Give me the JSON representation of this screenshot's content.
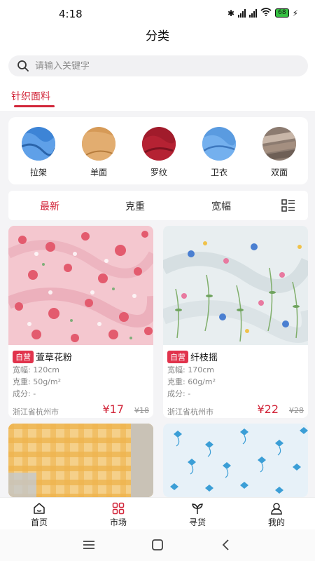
{
  "status_bar": {
    "time": "4:18",
    "battery": "68",
    "signal1": "HD",
    "signal2": "HD"
  },
  "header": {
    "title": "分类"
  },
  "search": {
    "placeholder": "请输入关键字"
  },
  "category_tab": {
    "label": "针织面料"
  },
  "categories": [
    {
      "label": "拉架",
      "color": "#3d84d6"
    },
    {
      "label": "单面",
      "color": "#d69a57"
    },
    {
      "label": "罗纹",
      "color": "#a11b2b"
    },
    {
      "label": "卫衣",
      "color": "#5a9be0"
    },
    {
      "label": "双面",
      "color": "#8c7b70"
    }
  ],
  "sort": {
    "latest": "最新",
    "weight": "克重",
    "width": "宽幅",
    "layout_icon": "list-layout-icon"
  },
  "products": [
    {
      "tag": "自营",
      "name": "萱草花粉",
      "width": "宽幅: 120cm",
      "weight": "克重: 50g/m²",
      "composition": "成分: -",
      "location": "浙江省杭州市",
      "price": "¥17",
      "original_price": "¥18"
    },
    {
      "tag": "自营",
      "name": "纤枝摇",
      "width": "宽幅: 170cm",
      "weight": "克重: 60g/m²",
      "composition": "成分: -",
      "location": "浙江省杭州市",
      "price": "¥22",
      "original_price": "¥28"
    }
  ],
  "bottom_nav": [
    {
      "label": "首页",
      "icon": "home-icon"
    },
    {
      "label": "市场",
      "icon": "market-icon"
    },
    {
      "label": "寻货",
      "icon": "sprout-icon"
    },
    {
      "label": "我的",
      "icon": "profile-icon"
    }
  ],
  "colors": {
    "accent": "#d2263a",
    "tag": "#e1334c"
  }
}
